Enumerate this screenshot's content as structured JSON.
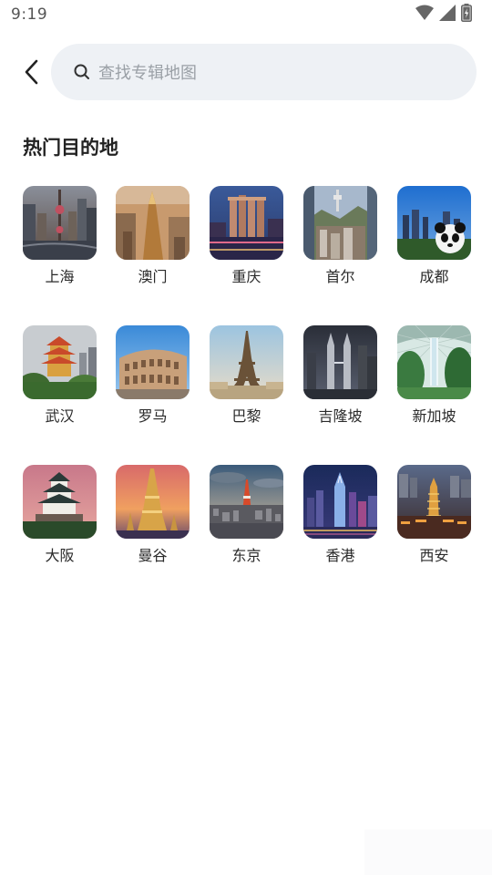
{
  "status_bar": {
    "time": "9:19",
    "icons": [
      "wifi-icon",
      "signal-icon",
      "battery-icon"
    ]
  },
  "header": {
    "back_icon": "chevron-left-icon",
    "search": {
      "icon": "search-icon",
      "placeholder": "查找专辑地图"
    }
  },
  "section": {
    "title": "热门目的地"
  },
  "destinations": [
    {
      "name": "上海",
      "landmark": "oriental-pearl-tower"
    },
    {
      "name": "澳门",
      "landmark": "grand-lisboa"
    },
    {
      "name": "重庆",
      "landmark": "raffles-city-night"
    },
    {
      "name": "首尔",
      "landmark": "n-seoul-tower"
    },
    {
      "name": "成都",
      "landmark": "panda-skyline"
    },
    {
      "name": "武汉",
      "landmark": "yellow-crane-tower"
    },
    {
      "name": "罗马",
      "landmark": "colosseum"
    },
    {
      "name": "巴黎",
      "landmark": "eiffel-tower"
    },
    {
      "name": "吉隆坡",
      "landmark": "petronas-towers"
    },
    {
      "name": "新加坡",
      "landmark": "jewel-rain-vortex"
    },
    {
      "name": "大阪",
      "landmark": "osaka-castle"
    },
    {
      "name": "曼谷",
      "landmark": "wat-arun"
    },
    {
      "name": "东京",
      "landmark": "tokyo-tower"
    },
    {
      "name": "香港",
      "landmark": "victoria-harbour-night"
    },
    {
      "name": "西安",
      "landmark": "big-wild-goose-pagoda"
    }
  ],
  "colors": {
    "search_bg": "#eef1f5",
    "placeholder": "#9aa0a6",
    "title": "#222222",
    "label": "#2a2a2a"
  }
}
